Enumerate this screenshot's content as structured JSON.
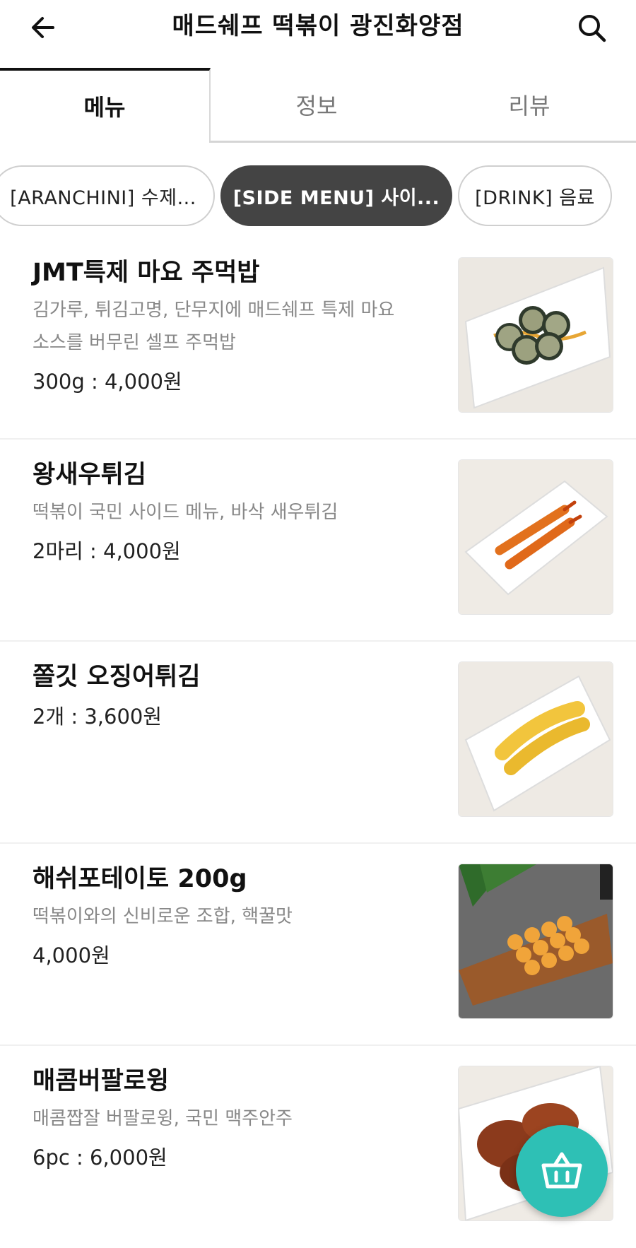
{
  "header": {
    "title": "매드쉐프 떡볶이 광진화양점",
    "back_icon": "arrow-left-icon",
    "search_icon": "search-icon"
  },
  "tabs": [
    {
      "label": "메뉴",
      "active": true
    },
    {
      "label": "정보",
      "active": false
    },
    {
      "label": "리뷰",
      "active": false
    }
  ],
  "categories": [
    {
      "label": "[ARANCHINI] 수제...",
      "active": false
    },
    {
      "label": "[SIDE MENU] 사이...",
      "active": true
    },
    {
      "label": "[DRINK] 음료",
      "active": false
    }
  ],
  "menu_items": [
    {
      "name": "JMT특제 마요 주먹밥",
      "description": "김가루, 튀김고명, 단무지에 매드쉐프 특제 마요소스를 버무린 셀프 주먹밥",
      "price": "300g : 4,000원"
    },
    {
      "name": "왕새우튀김",
      "description": "떡볶이 국민 사이드 메뉴, 바삭 새우튀김",
      "price": "2마리 : 4,000원"
    },
    {
      "name": "쫄깃 오징어튀김",
      "description": "",
      "price": "2개 : 3,600원"
    },
    {
      "name": "해쉬포테이토 200g",
      "description": "떡볶이와의 신비로운 조합, 핵꿀맛",
      "price": "4,000원"
    },
    {
      "name": "매콤버팔로윙",
      "description": "매콤짭잘 버팔로윙, 국민 맥주안주",
      "price": "6pc : 6,000원"
    }
  ],
  "cart": {
    "icon": "shopping-basket-icon"
  },
  "colors": {
    "accent": "#2ec0b5",
    "active_chip": "#444444",
    "tab_indicator": "#111111"
  }
}
